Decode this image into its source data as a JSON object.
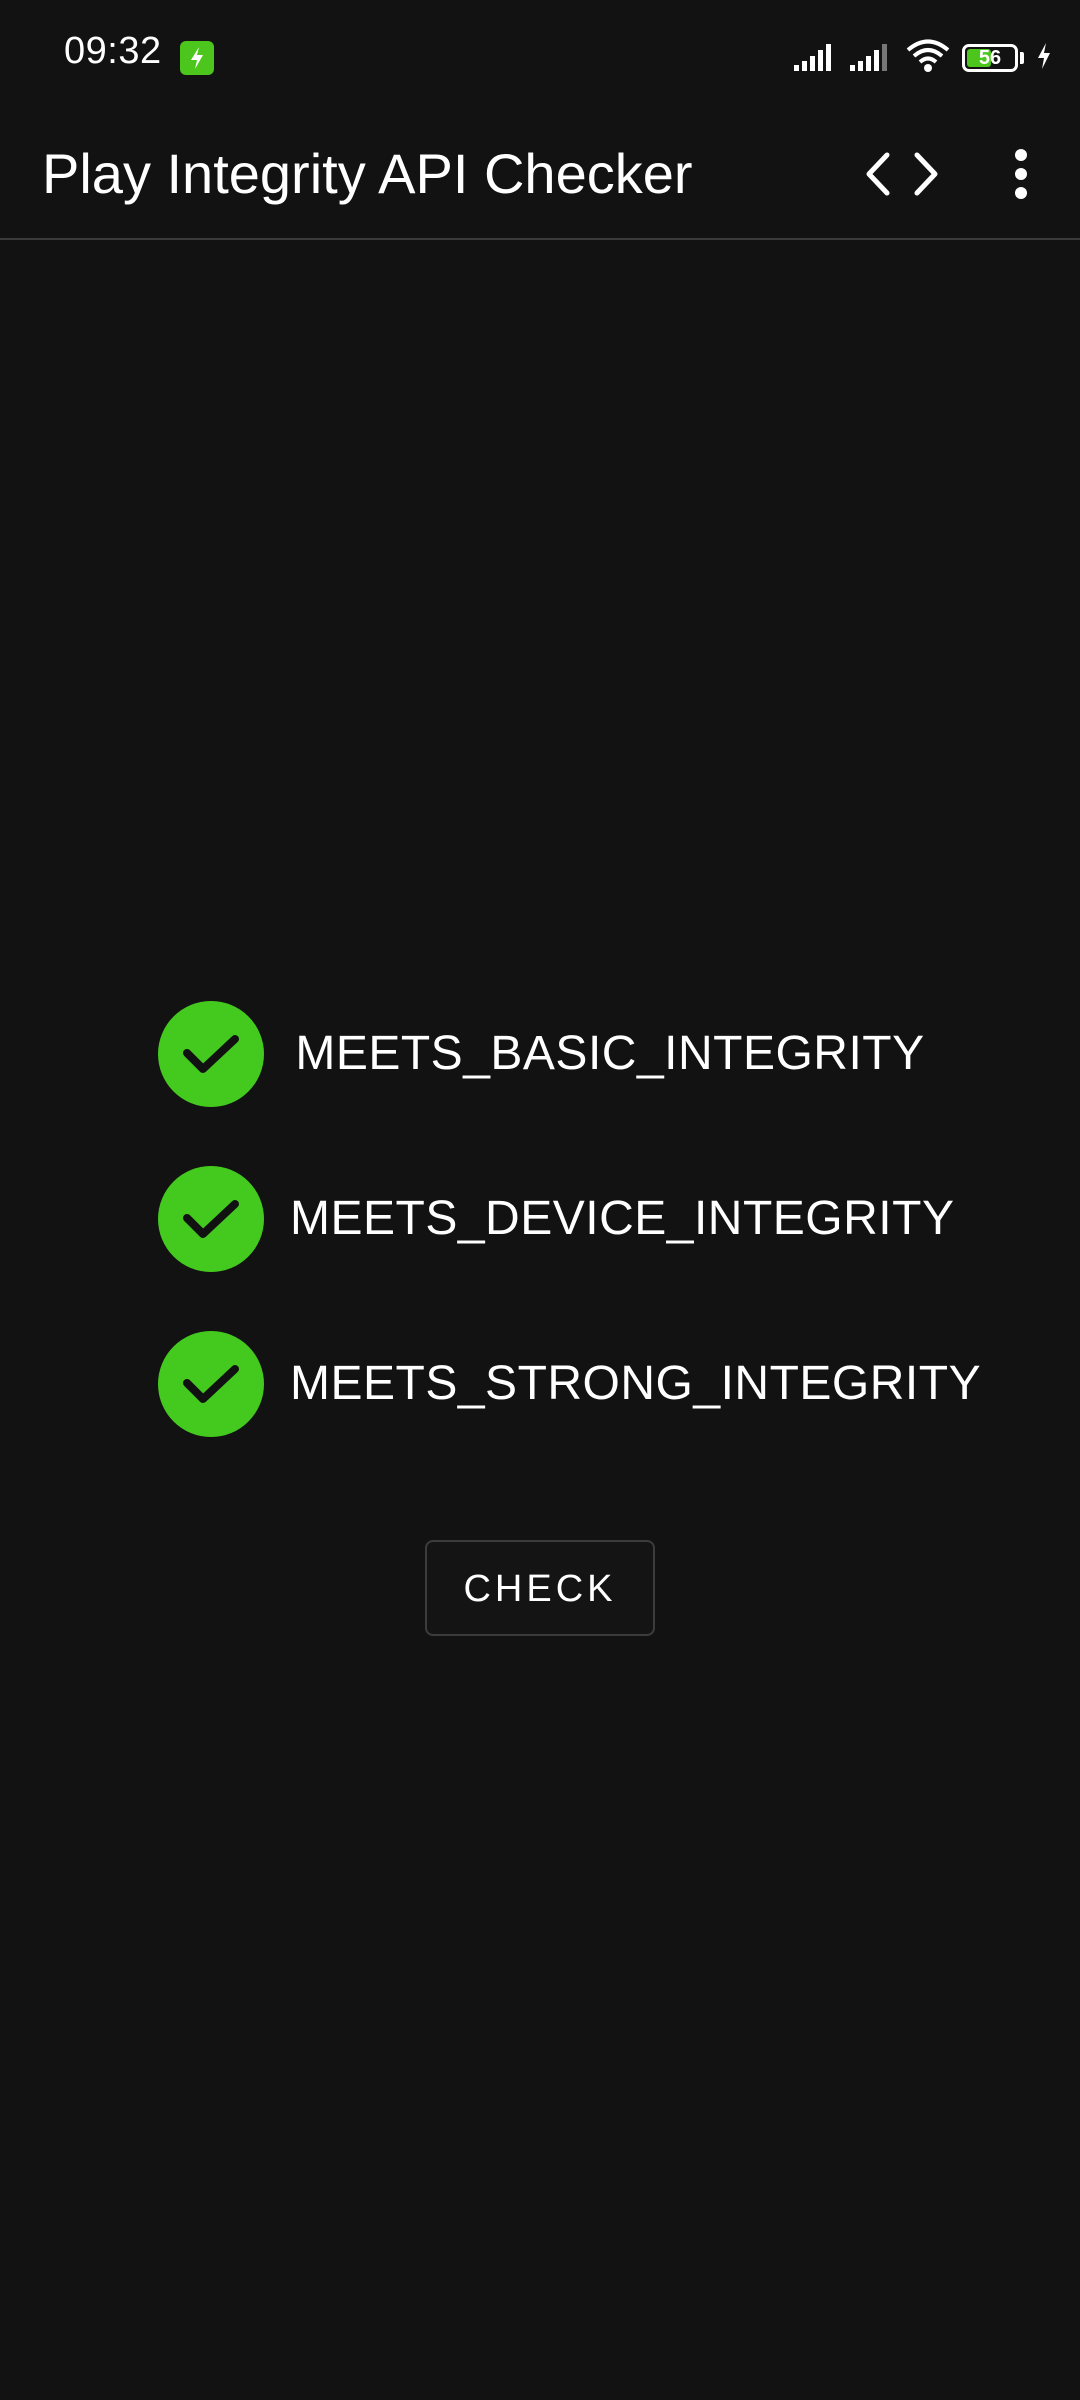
{
  "status_bar": {
    "time": "09:32",
    "battery_level": "56",
    "battery_fraction": 0.56,
    "accent_color": "#4cc61c",
    "icons": [
      "charging-badge-icon",
      "signal-icon",
      "signal-icon",
      "wifi-icon",
      "battery-icon",
      "charging-bolt-icon"
    ]
  },
  "app_bar": {
    "title": "Play Integrity API Checker",
    "actions": [
      "code-icon",
      "more-vert-icon"
    ]
  },
  "checks": [
    {
      "label": "MEETS_BASIC_INTEGRITY",
      "passed": true
    },
    {
      "label": "MEETS_DEVICE_INTEGRITY",
      "passed": true
    },
    {
      "label": "MEETS_STRONG_INTEGRITY",
      "passed": true
    }
  ],
  "check_color": "#44c91e",
  "button": {
    "label": "CHECK"
  }
}
